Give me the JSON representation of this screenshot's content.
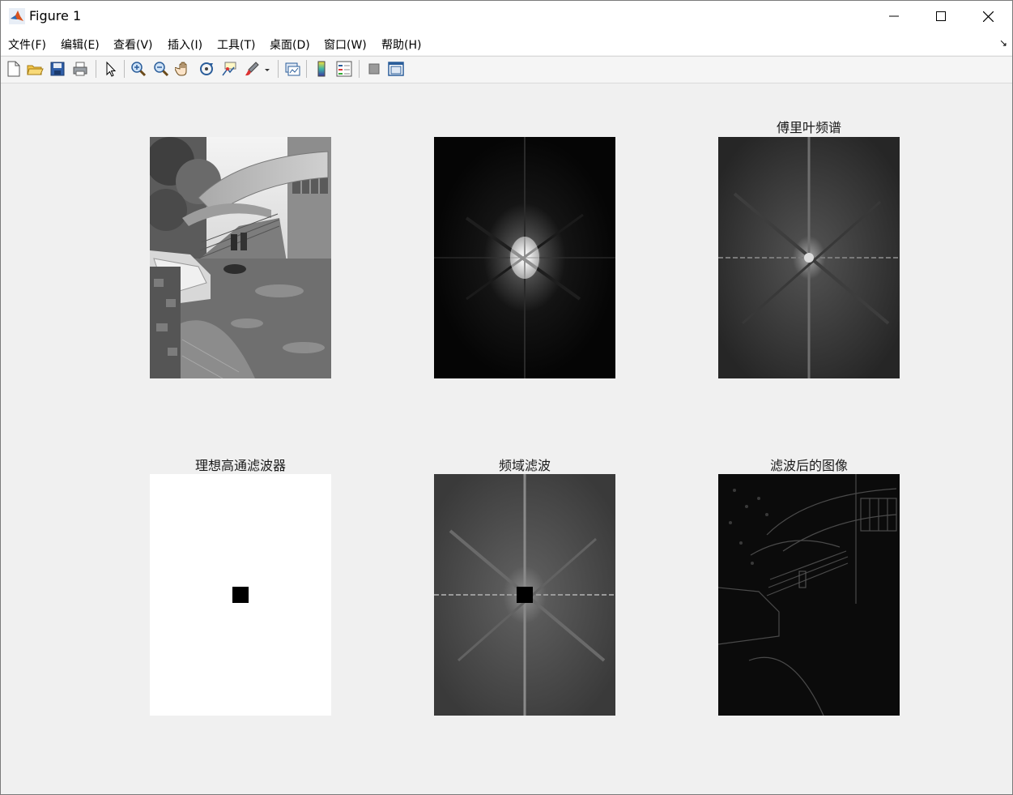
{
  "window": {
    "title": "Figure 1"
  },
  "menu": [
    "文件(F)",
    "编辑(E)",
    "查看(V)",
    "插入(I)",
    "工具(T)",
    "桌面(D)",
    "窗口(W)",
    "帮助(H)"
  ],
  "toolbar_icons": [
    "new-figure-icon",
    "open-file-icon",
    "save-icon",
    "print-icon",
    "pointer-icon",
    "zoom-in-icon",
    "zoom-out-icon",
    "pan-icon",
    "rotate-3d-icon",
    "data-cursor-icon",
    "brush-icon",
    "link-plot-icon",
    "colorbar-icon",
    "legend-icon",
    "hide-plot-tools-icon",
    "show-plot-tools-icon"
  ],
  "subplots": [
    {
      "title": "",
      "content": "grayscale photo"
    },
    {
      "title": "",
      "content": "fourier spectrum"
    },
    {
      "title": "傅里叶频谱",
      "content": "log fourier spectrum"
    },
    {
      "title": "理想高通滤波器",
      "content": "ideal highpass filter mask"
    },
    {
      "title": "频域滤波",
      "content": "filtered spectrum"
    },
    {
      "title": "滤波后的图像",
      "content": "filtered image edges"
    }
  ],
  "colors": {
    "figure_bg": "#f0f0f0",
    "titlebar_bg": "#ffffff"
  }
}
